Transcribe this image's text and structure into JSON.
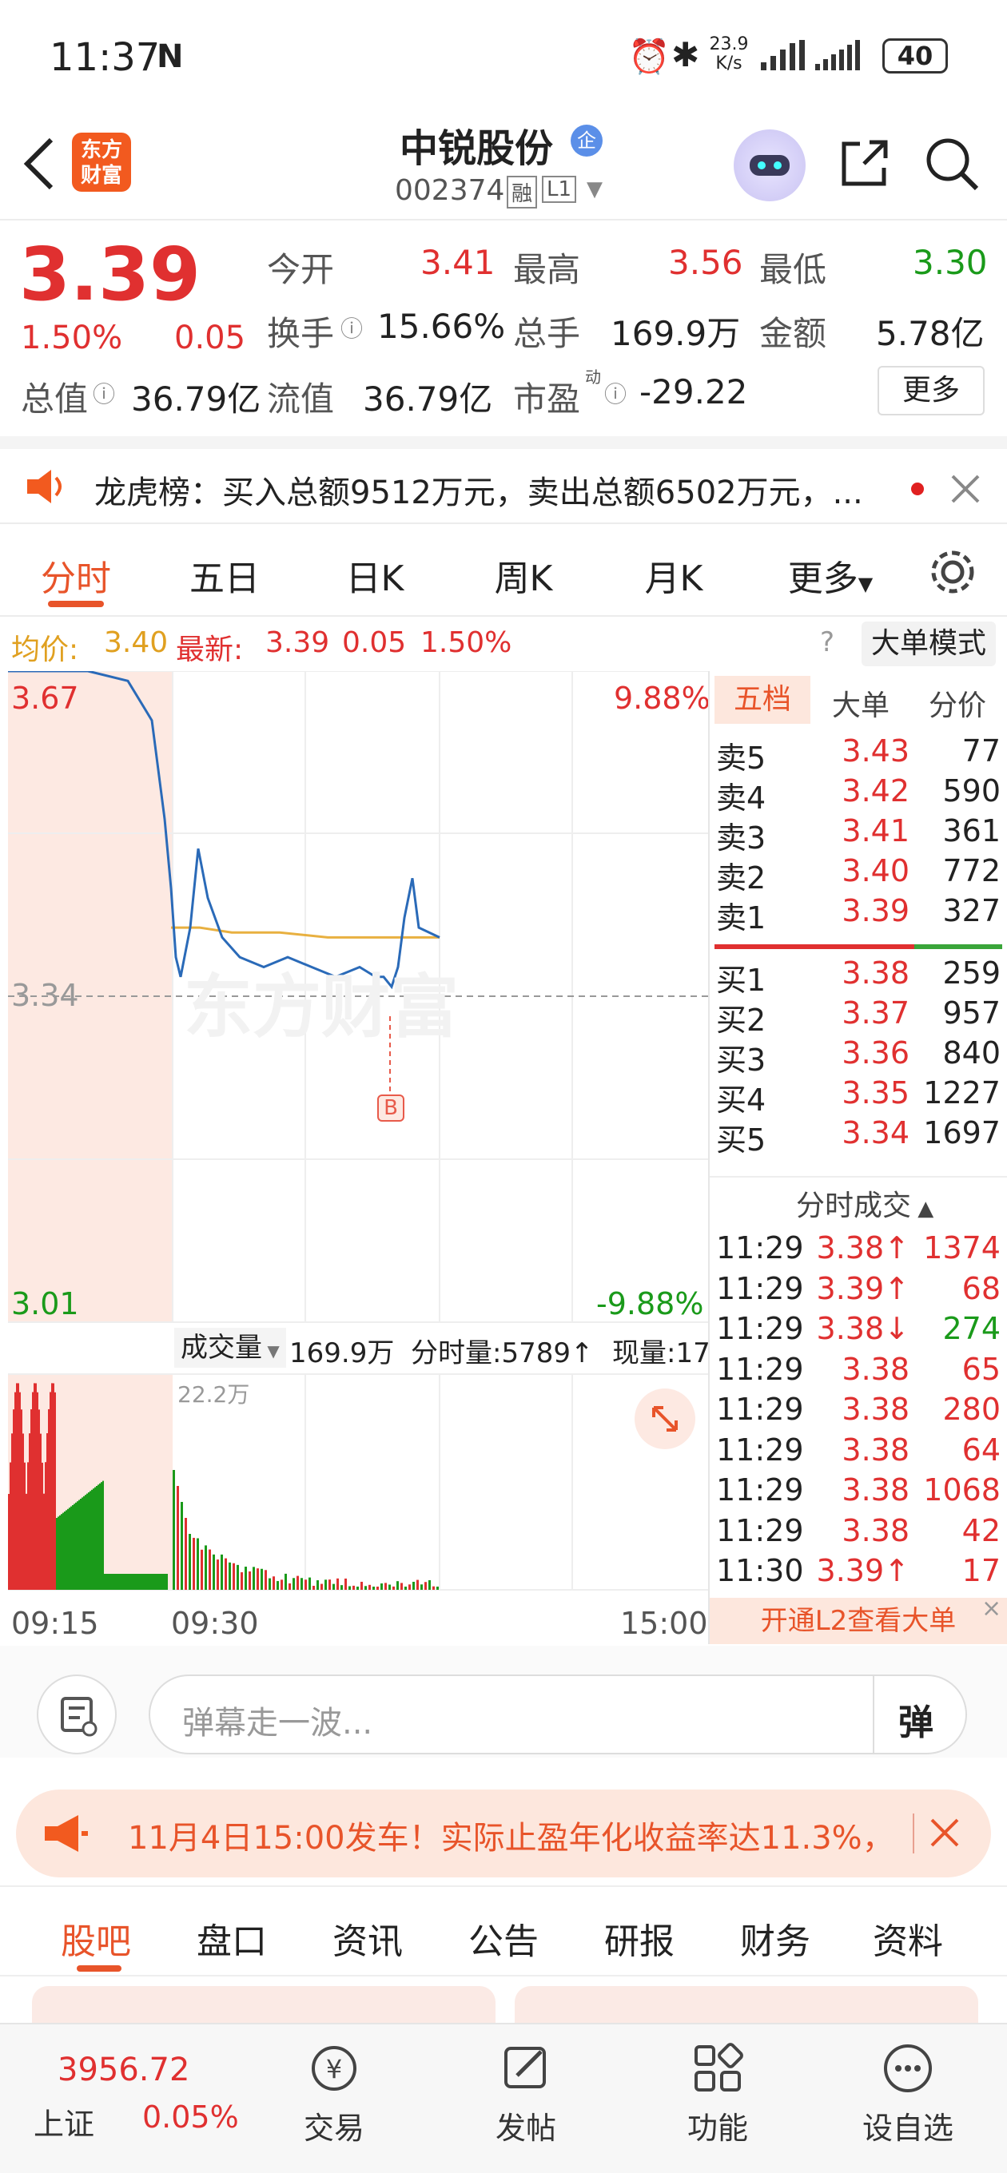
{
  "status": {
    "time": "11:37",
    "net_speed_top": "23.9",
    "net_speed_unit": "K/s",
    "battery": "40"
  },
  "header": {
    "logo_line1": "东方",
    "logo_line2": "财富",
    "name": "中锐股份",
    "badge": "企",
    "code": "002374",
    "tag_rong": "融",
    "tag_l1": "L1"
  },
  "quote": {
    "price": "3.39",
    "pct": "1.50%",
    "chg": "0.05",
    "open_label": "今开",
    "open": "3.41",
    "high_label": "最高",
    "high": "3.56",
    "low_label": "最低",
    "low": "3.30",
    "turnover_label": "换手",
    "turnover": "15.66%",
    "volume_label": "总手",
    "volume": "169.9万",
    "amount_label": "金额",
    "amount": "5.78亿",
    "mktcap_label": "总值",
    "mktcap": "36.79亿",
    "float_label": "流值",
    "float": "36.79亿",
    "pe_label": "市盈",
    "pe_sup": "动",
    "pe": "-29.22",
    "more": "更多"
  },
  "news": {
    "text": "龙虎榜：买入总额9512万元，卖出总额6502万元，..."
  },
  "tabs": [
    "分时",
    "五日",
    "日K",
    "周K",
    "月K",
    "更多"
  ],
  "avgbar": {
    "avg_label": "均价:",
    "avg": "3.40",
    "last_label": "最新:",
    "last": "3.39",
    "chg": "0.05",
    "pct": "1.50%",
    "mode": "大单模式"
  },
  "chart": {
    "top_price": "3.67",
    "mid_price": "3.34",
    "bottom_price": "3.01",
    "top_pct": "9.88%",
    "bottom_pct": "-9.88%",
    "marker": "B",
    "vol_label": "成交量",
    "vol_total": "169.9万",
    "vol_min": "分时量:5789↑",
    "vol_now": "现量:17",
    "vol_max": "22.2万",
    "t_start": "09:15",
    "t_mid": "09:30",
    "t_end": "15:00",
    "watermark": "东方财富"
  },
  "chart_data": {
    "type": "line",
    "x": [
      "09:15",
      "09:30",
      "15:00"
    ],
    "ylim": [
      3.01,
      3.67
    ],
    "prev_close": 3.34,
    "series": [
      {
        "values": [
          3.67,
          3.67,
          3.66,
          3.62,
          3.52,
          3.45,
          3.38,
          3.36,
          3.41,
          3.49,
          3.44,
          3.4,
          3.38,
          3.37,
          3.38,
          3.37,
          3.36,
          3.37,
          3.36,
          3.36,
          3.35,
          3.37,
          3.42,
          3.46,
          3.41,
          3.4
        ]
      },
      {
        "values": [
          3.41,
          3.41,
          3.41,
          3.41,
          3.405,
          3.405,
          3.4,
          3.4,
          3.4,
          3.4
        ]
      }
    ],
    "volume_ylim": [
      0,
      222000
    ]
  },
  "orderbook": {
    "tabs": [
      "五档",
      "大单",
      "分价"
    ],
    "asks": [
      {
        "l": "卖5",
        "p": "3.43",
        "v": "77"
      },
      {
        "l": "卖4",
        "p": "3.42",
        "v": "590"
      },
      {
        "l": "卖3",
        "p": "3.41",
        "v": "361"
      },
      {
        "l": "卖2",
        "p": "3.40",
        "v": "772"
      },
      {
        "l": "卖1",
        "p": "3.39",
        "v": "327"
      }
    ],
    "bids": [
      {
        "l": "买1",
        "p": "3.38",
        "v": "259"
      },
      {
        "l": "买2",
        "p": "3.37",
        "v": "957"
      },
      {
        "l": "买3",
        "p": "3.36",
        "v": "840"
      },
      {
        "l": "买4",
        "p": "3.35",
        "v": "1227"
      },
      {
        "l": "买5",
        "p": "3.34",
        "v": "1697"
      }
    ],
    "ticks_title": "分时成交",
    "ticks": [
      {
        "t": "11:29",
        "p": "3.38↑",
        "v": "1374"
      },
      {
        "t": "11:29",
        "p": "3.39↑",
        "v": "68"
      },
      {
        "t": "11:29",
        "p": "3.38↓",
        "v": "274"
      },
      {
        "t": "11:29",
        "p": "3.38",
        "v": "65"
      },
      {
        "t": "11:29",
        "p": "3.38",
        "v": "280"
      },
      {
        "t": "11:29",
        "p": "3.38",
        "v": "64"
      },
      {
        "t": "11:29",
        "p": "3.38",
        "v": "1068"
      },
      {
        "t": "11:29",
        "p": "3.38",
        "v": "42"
      },
      {
        "t": "11:30",
        "p": "3.39↑",
        "v": "17"
      }
    ],
    "l2": "开通L2查看大单"
  },
  "danmaku": {
    "placeholder": "弹幕走一波...",
    "btn": "弹"
  },
  "ad": {
    "text": "11月4日15:00发车！实际止盈年化收益率达11.3%，"
  },
  "tabs2": [
    "股吧",
    "盘口",
    "资讯",
    "公告",
    "研报",
    "财务",
    "资料"
  ],
  "bottom": {
    "index_value": "3956.72",
    "index_name": "上证",
    "index_pct": "0.05%",
    "nav": [
      "交易",
      "发帖",
      "功能",
      "设自选"
    ]
  }
}
